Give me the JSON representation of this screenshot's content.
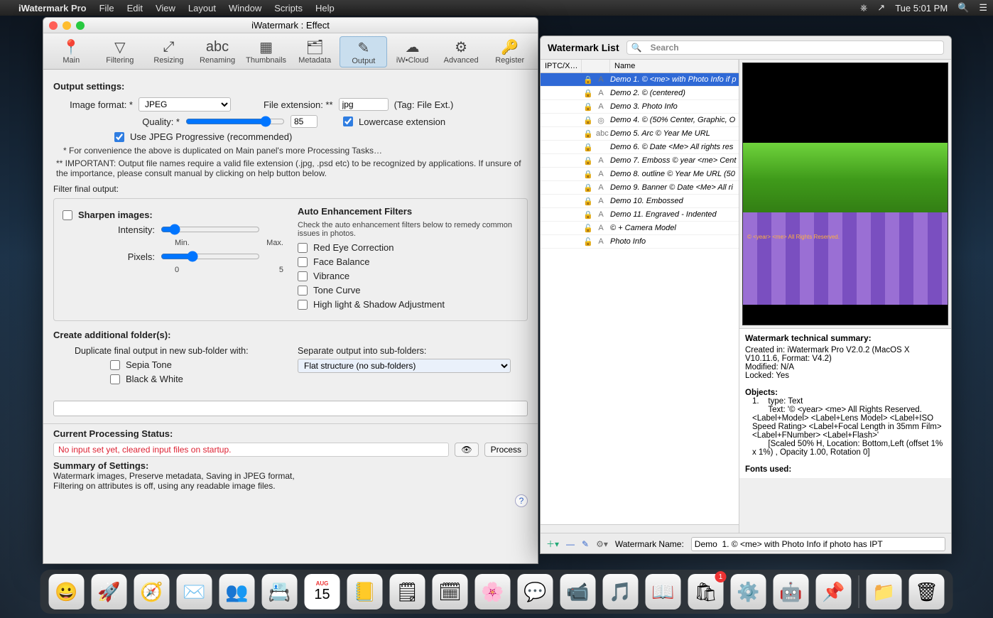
{
  "menubar": {
    "app": "iWatermark Pro",
    "items": [
      "File",
      "Edit",
      "View",
      "Layout",
      "Window",
      "Scripts",
      "Help"
    ],
    "clock": "Tue 5:01 PM"
  },
  "effect_window": {
    "title": "iWatermark : Effect",
    "toolbar": [
      {
        "label": "Main",
        "icon": "📍"
      },
      {
        "label": "Filtering",
        "icon": "▽"
      },
      {
        "label": "Resizing",
        "icon": "⤢"
      },
      {
        "label": "Renaming",
        "icon": "abc"
      },
      {
        "label": "Thumbnails",
        "icon": "▦"
      },
      {
        "label": "Metadata",
        "icon": "🗂"
      },
      {
        "label": "Output",
        "icon": "✎",
        "selected": true
      },
      {
        "label": "iW•Cloud",
        "icon": "☁"
      },
      {
        "label": "Advanced",
        "icon": "⚙"
      },
      {
        "label": "Register",
        "icon": "🔑"
      }
    ],
    "output": {
      "heading": "Output settings:",
      "image_format_label": "Image format: *",
      "image_format_value": "JPEG",
      "file_ext_label": "File extension: **",
      "file_ext_value": "jpg",
      "file_ext_tag": "(Tag: File Ext.)",
      "quality_label": "Quality: *",
      "quality_value": "85",
      "lowercase_label": "Lowercase extension",
      "jpeg_prog_label": "Use JPEG Progressive (recommended)",
      "note1": "* For convenience the above is duplicated on Main panel's more Processing Tasks…",
      "note2": "** IMPORTANT: Output file names require a valid file extension (.jpg, .psd etc) to be recognized by applications. If unsure of the importance, please consult manual by clicking on help button below.",
      "filter_heading": "Filter final output:",
      "sharpen_label": "Sharpen images:",
      "intensity_label": "Intensity:",
      "min": "Min.",
      "max": "Max.",
      "pixels_label": "Pixels:",
      "p0": "0",
      "p5": "5",
      "auto_heading": "Auto Enhancement Filters",
      "auto_sub": "Check the auto enhancement filters below to remedy common issues in photos.",
      "filters": [
        "Red Eye Correction",
        "Face Balance",
        "Vibrance",
        "Tone Curve",
        "High light & Shadow Adjustment"
      ],
      "create_folders_heading": "Create additional folder(s):",
      "dup_label": "Duplicate final output in new sub-folder with:",
      "sepia": "Sepia Tone",
      "bw": "Black & White",
      "separate_label": "Separate output into sub-folders:",
      "separate_value": "Flat structure (no sub-folders)",
      "status_heading": "Current Processing Status:",
      "status_text": "No input set yet, cleared input files on startup.",
      "process": "Process",
      "summary_heading": "Summary of Settings:",
      "summary_text": "Watermark images, Preserve metadata, Saving in JPEG format,\nFiltering on attributes is off, using any readable image files."
    }
  },
  "wm_window": {
    "title": "Watermark List",
    "search_placeholder": "Search",
    "cols": {
      "c1": "IPTC/X…",
      "c2": "",
      "c3": "Name"
    },
    "rows": [
      {
        "lock": "🔒",
        "t": "A",
        "name": "Demo  1. © <me> with Photo Info if p",
        "sel": true
      },
      {
        "lock": "🔒",
        "t": "A",
        "name": "Demo  2. © (centered)"
      },
      {
        "lock": "🔒",
        "t": "A",
        "name": "Demo  3. Photo Info"
      },
      {
        "lock": "🔒",
        "t": "◎",
        "name": "Demo  4. © (50% Center, Graphic, O"
      },
      {
        "lock": "🔒",
        "t": "abc",
        "name": "Demo  5. Arc © Year Me URL"
      },
      {
        "lock": "🔒",
        "t": "",
        "name": "Demo  6. © Date <Me> All rights res"
      },
      {
        "lock": "🔒",
        "t": "A",
        "name": "Demo  7. Emboss © year <me> Cent"
      },
      {
        "lock": "🔒",
        "t": "A",
        "name": "Demo  8. outline © Year Me URL (50"
      },
      {
        "lock": "🔒",
        "t": "A",
        "name": "Demo  9. Banner © Date <Me> All ri"
      },
      {
        "lock": "🔒",
        "t": "A",
        "name": "Demo 10. Embossed"
      },
      {
        "lock": "🔒",
        "t": "A",
        "name": "Demo 11. Engraved - Indented"
      },
      {
        "lock": "🔓",
        "t": "A",
        "name": "© + Camera Model"
      },
      {
        "lock": "🔓",
        "t": "A",
        "name": "Photo Info"
      }
    ],
    "preview_stamp": "© <year> <me> All Rights Reserved.",
    "tech": {
      "heading": "Watermark technical summary:",
      "l1": "Created in: iWatermark Pro V2.0.2 (MacOS X V10.11.6, Format: V4.2)",
      "l2": "Modified: N/A",
      "l3": "Locked: Yes",
      "objects_h": "Objects:",
      "obj": "1.    type: Text\n       Text: '© <year> <me> All Rights Reserved. <Label+Model> <Label+Lens Model> <Label+ISO Speed Rating> <Label+Focal Length in 35mm Film> <Label+FNumber> <Label+Flash>'\n       [Scaled 50% H, Location: Bottom,Left (offset 1% x 1%) , Opacity 1.00, Rotation 0]",
      "fonts_h": "Fonts used:"
    },
    "footer": {
      "name_label": "Watermark Name:",
      "name_value": "Demo  1. © <me> with Photo Info if photo has IPT"
    }
  },
  "dock": {
    "apps": [
      "😀",
      "🚀",
      "🧭",
      "✉️",
      "👥",
      "📇",
      "📅",
      "📒",
      "🗒",
      "🗓",
      "🌸",
      "💬",
      "📹",
      "🎵",
      "📖",
      "🛍",
      "⚙️",
      "🤖",
      "📌",
      "📁",
      "🗑"
    ],
    "badge_index": 15,
    "badge_text": "1",
    "cal_day": "15",
    "cal_month": "AUG"
  }
}
